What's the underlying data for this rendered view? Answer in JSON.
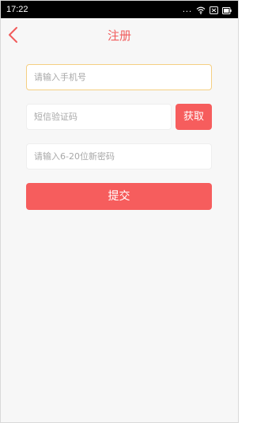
{
  "status_bar": {
    "time": "17:22",
    "dots": "...",
    "icons": [
      "wifi-icon",
      "sim-card-icon",
      "battery-icon"
    ]
  },
  "header": {
    "title": "注册",
    "back_icon": "chevron-left-icon"
  },
  "form": {
    "phone_placeholder": "请输入手机号",
    "code_placeholder": "短信验证码",
    "get_code_label": "获取",
    "password_placeholder": "请输入6-20位新密码",
    "submit_label": "提交"
  },
  "colors": {
    "accent": "#f65d5d",
    "title": "#f15b5b",
    "focus_border": "#f5cf82",
    "background": "#f7f7f7"
  }
}
